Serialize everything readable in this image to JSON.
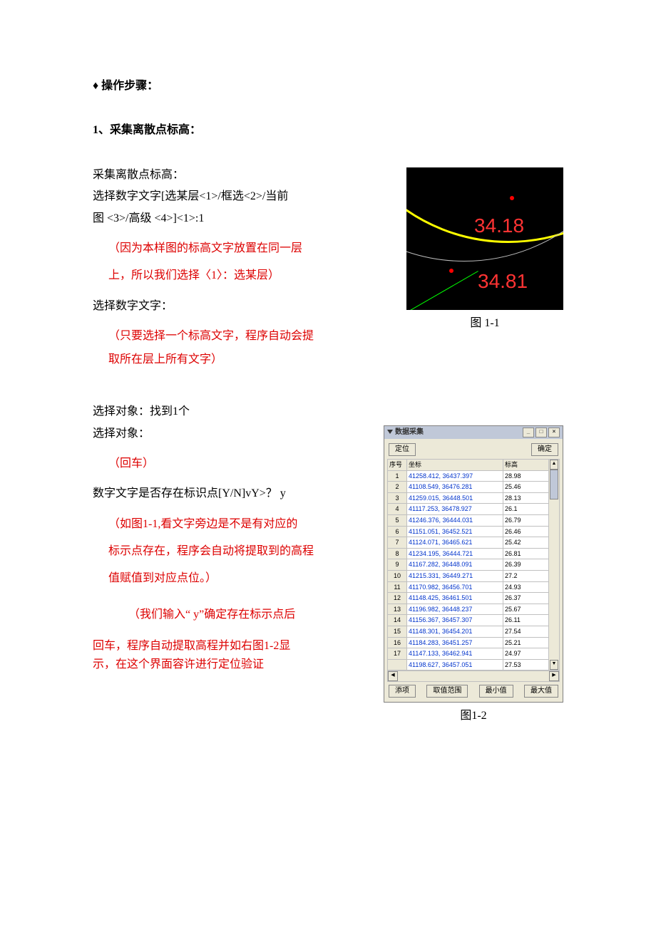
{
  "heading_main": "操作步骤：",
  "heading_step1": "1、采集离散点标高：",
  "text": {
    "p1": "采集离散点标高：",
    "p2a": "选择数字文字[选某层<1>/框选<2>/当前",
    "p2b": "图 <3>/高级 <4>]<1>:1",
    "red1a": "（因为本样图的标高文字放置在同一层",
    "red1b": "上，所以我们选择〈1〉：选某层）",
    "p3": "选择数字文字：",
    "red2a": "（只要选择一个标高文字，程序自动会提",
    "red2b": "取所在层上所有文字）",
    "p4": "选择对象：找到1个",
    "p5": "选择对象：",
    "red3": "（回车）",
    "p6": "数字文字是否存在标识点[Y/N]vY>？ y",
    "red4a": "（如图1-1,看文字旁边是不是有对应的",
    "red4b": "标示点存在，程序会自动将提取到的高程",
    "red4c": "值赋值到对应点位。）",
    "red5a": "（我们输入“ y”确定存在标示点后",
    "red5b": "回车，程序自动提取高程并如右图1-2显",
    "red5c": "示，在这个界面容许进行定位验证"
  },
  "fig11": {
    "caption": "图 1-1",
    "elev1": "34.18",
    "elev2": "34.81"
  },
  "fig12": {
    "caption": "图1-2",
    "title": "数据采集",
    "btn_locate": "定位",
    "btn_ok": "确定",
    "th_seq": "序号",
    "th_coord": "坐标",
    "th_elev": "标高",
    "btn_addrow": "添项",
    "btn_range": "取值范围",
    "btn_min": "最小值",
    "btn_max": "最大值",
    "rows": [
      {
        "seq": "1",
        "coord": "41258.412, 36437.397",
        "elev": "28.98"
      },
      {
        "seq": "2",
        "coord": "41108.549, 36476.281",
        "elev": "25.46"
      },
      {
        "seq": "3",
        "coord": "41259.015, 36448.501",
        "elev": "28.13"
      },
      {
        "seq": "4",
        "coord": "41117.253, 36478.927",
        "elev": "26.1"
      },
      {
        "seq": "5",
        "coord": "41246.376, 36444.031",
        "elev": "26.79"
      },
      {
        "seq": "6",
        "coord": "41151.051, 36452.521",
        "elev": "26.46"
      },
      {
        "seq": "7",
        "coord": "41124.071, 36465.621",
        "elev": "25.42"
      },
      {
        "seq": "8",
        "coord": "41234.195, 36444.721",
        "elev": "26.81"
      },
      {
        "seq": "9",
        "coord": "41167.282, 36448.091",
        "elev": "26.39"
      },
      {
        "seq": "10",
        "coord": "41215.331, 36449.271",
        "elev": "27.2"
      },
      {
        "seq": "11",
        "coord": "41170.982, 36456.701",
        "elev": "24.93"
      },
      {
        "seq": "12",
        "coord": "41148.425, 36461.501",
        "elev": "26.37"
      },
      {
        "seq": "13",
        "coord": "41196.982, 36448.237",
        "elev": "25.67"
      },
      {
        "seq": "14",
        "coord": "41156.367, 36457.307",
        "elev": "26.11"
      },
      {
        "seq": "15",
        "coord": "41148.301, 36454.201",
        "elev": "27.54"
      },
      {
        "seq": "16",
        "coord": "41184.283, 36451.257",
        "elev": "25.21"
      },
      {
        "seq": "17",
        "coord": "41147.133, 36462.941",
        "elev": "24.97"
      },
      {
        "seq": "",
        "coord": "41198.627, 36457.051",
        "elev": "27.53"
      }
    ]
  }
}
